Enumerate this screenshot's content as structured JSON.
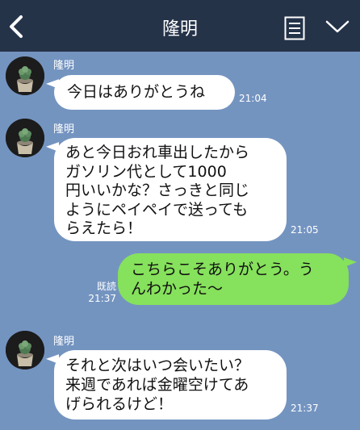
{
  "header": {
    "title": "隆明"
  },
  "contact_name": "隆明",
  "messages": [
    {
      "text": "今日はありがとうね",
      "time": "21:04"
    },
    {
      "text": "あと今日おれ車出したから\nガソリン代として1000\n円いいかな？さっきと同じ\nようにペイペイで送っても\nらえたら！",
      "time": "21:05"
    },
    {
      "text": "こちらこそありがとう。う\nんわかった〜",
      "read": "既読",
      "time": "21:37"
    },
    {
      "text": "それと次はいつ会いたい？\n来週であれば金曜空けてあ\nげられるけど！",
      "time": "21:37"
    }
  ]
}
